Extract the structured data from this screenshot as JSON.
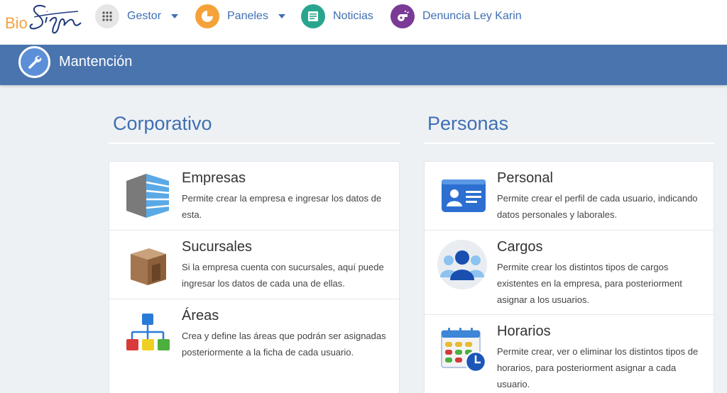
{
  "logo": {
    "text": "BioSign"
  },
  "nav": {
    "items": [
      {
        "label": "Gestor",
        "icon": "apps-grid-icon",
        "color": "#e6e6e6",
        "dropdown": true
      },
      {
        "label": "Paneles",
        "icon": "pie-chart-icon",
        "color": "#f5a23a",
        "dropdown": true
      },
      {
        "label": "Noticias",
        "icon": "news-icon",
        "color": "#29a58f",
        "dropdown": false
      },
      {
        "label": "Denuncia Ley Karin",
        "icon": "whistle-icon",
        "color": "#7a3a95",
        "dropdown": false
      }
    ]
  },
  "section": {
    "title": "Mantención",
    "icon": "wrench-icon",
    "color": "#4a74ae"
  },
  "columns": [
    {
      "heading": "Corporativo",
      "items": [
        {
          "title": "Empresas",
          "description": "Permite crear la empresa e ingresar los datos de esta.",
          "icon": "building-icon"
        },
        {
          "title": "Sucursales",
          "description": "Si la empresa cuenta con sucursales, aquí puede ingresar los datos de cada una de ellas.",
          "icon": "box-icon"
        },
        {
          "title": "Áreas",
          "description": "Crea y define las áreas que podrán ser asignadas posteriormente a la ficha de cada usuario.",
          "icon": "org-chart-icon"
        }
      ]
    },
    {
      "heading": "Personas",
      "items": [
        {
          "title": "Personal",
          "description": "Permite crear el perfil de cada usuario, indicando datos personales y laborales.",
          "icon": "id-card-icon"
        },
        {
          "title": "Cargos",
          "description": "Permite crear los distintos tipos de cargos existentes en la empresa, para posteriorment asignar a los usuarios.",
          "icon": "users-group-icon"
        },
        {
          "title": "Horarios",
          "description": "Permite crear, ver o eliminar los distintos tipos de horarios, para posteriorment asignar a cada usuario.",
          "icon": "calendar-clock-icon"
        }
      ]
    }
  ]
}
